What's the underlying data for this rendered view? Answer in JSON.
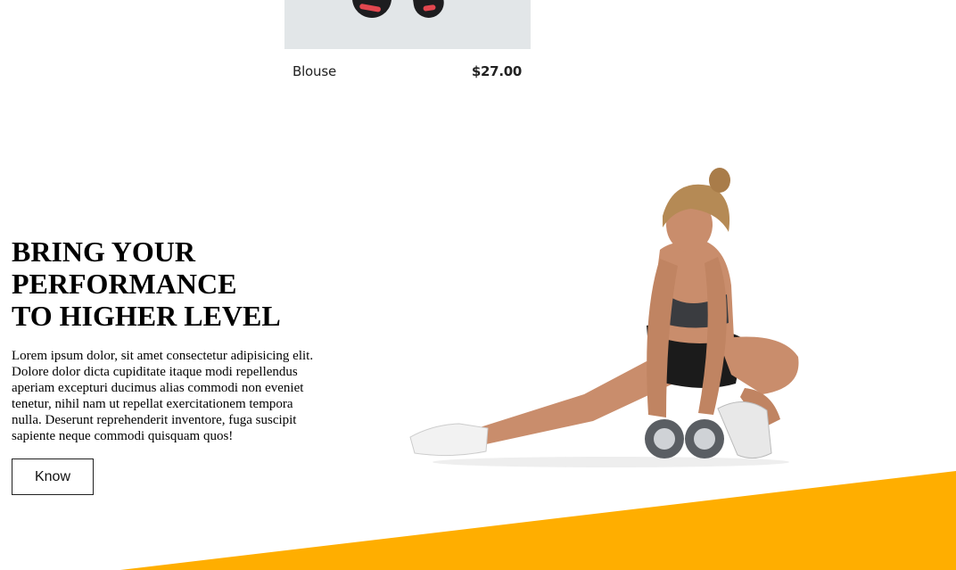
{
  "product": {
    "name": "Blouse",
    "price": "$27.00"
  },
  "hero": {
    "title_lines": [
      "BRING YOUR",
      "PERFORMANCE",
      "TO HIGHER LEVEL"
    ],
    "description": "Lorem ipsum dolor, sit amet consectetur adipisicing elit. Dolore dolor dicta cupiditate itaque modi repellendus aperiam excepturi ducimus alias commodi non eveniet tenetur, nihil nam ut repellat exercitationem tempora nulla. Deserunt reprehenderit inventore, fuga suscipit sapiente neque commodi quisquam quos!",
    "button_label": "Know"
  },
  "colors": {
    "accent": "#ffae00",
    "product_bg": "#e2e6e8",
    "text": "#000000"
  },
  "images": {
    "product": "sneakers",
    "hero": "woman-lunging-with-dumbbells"
  }
}
